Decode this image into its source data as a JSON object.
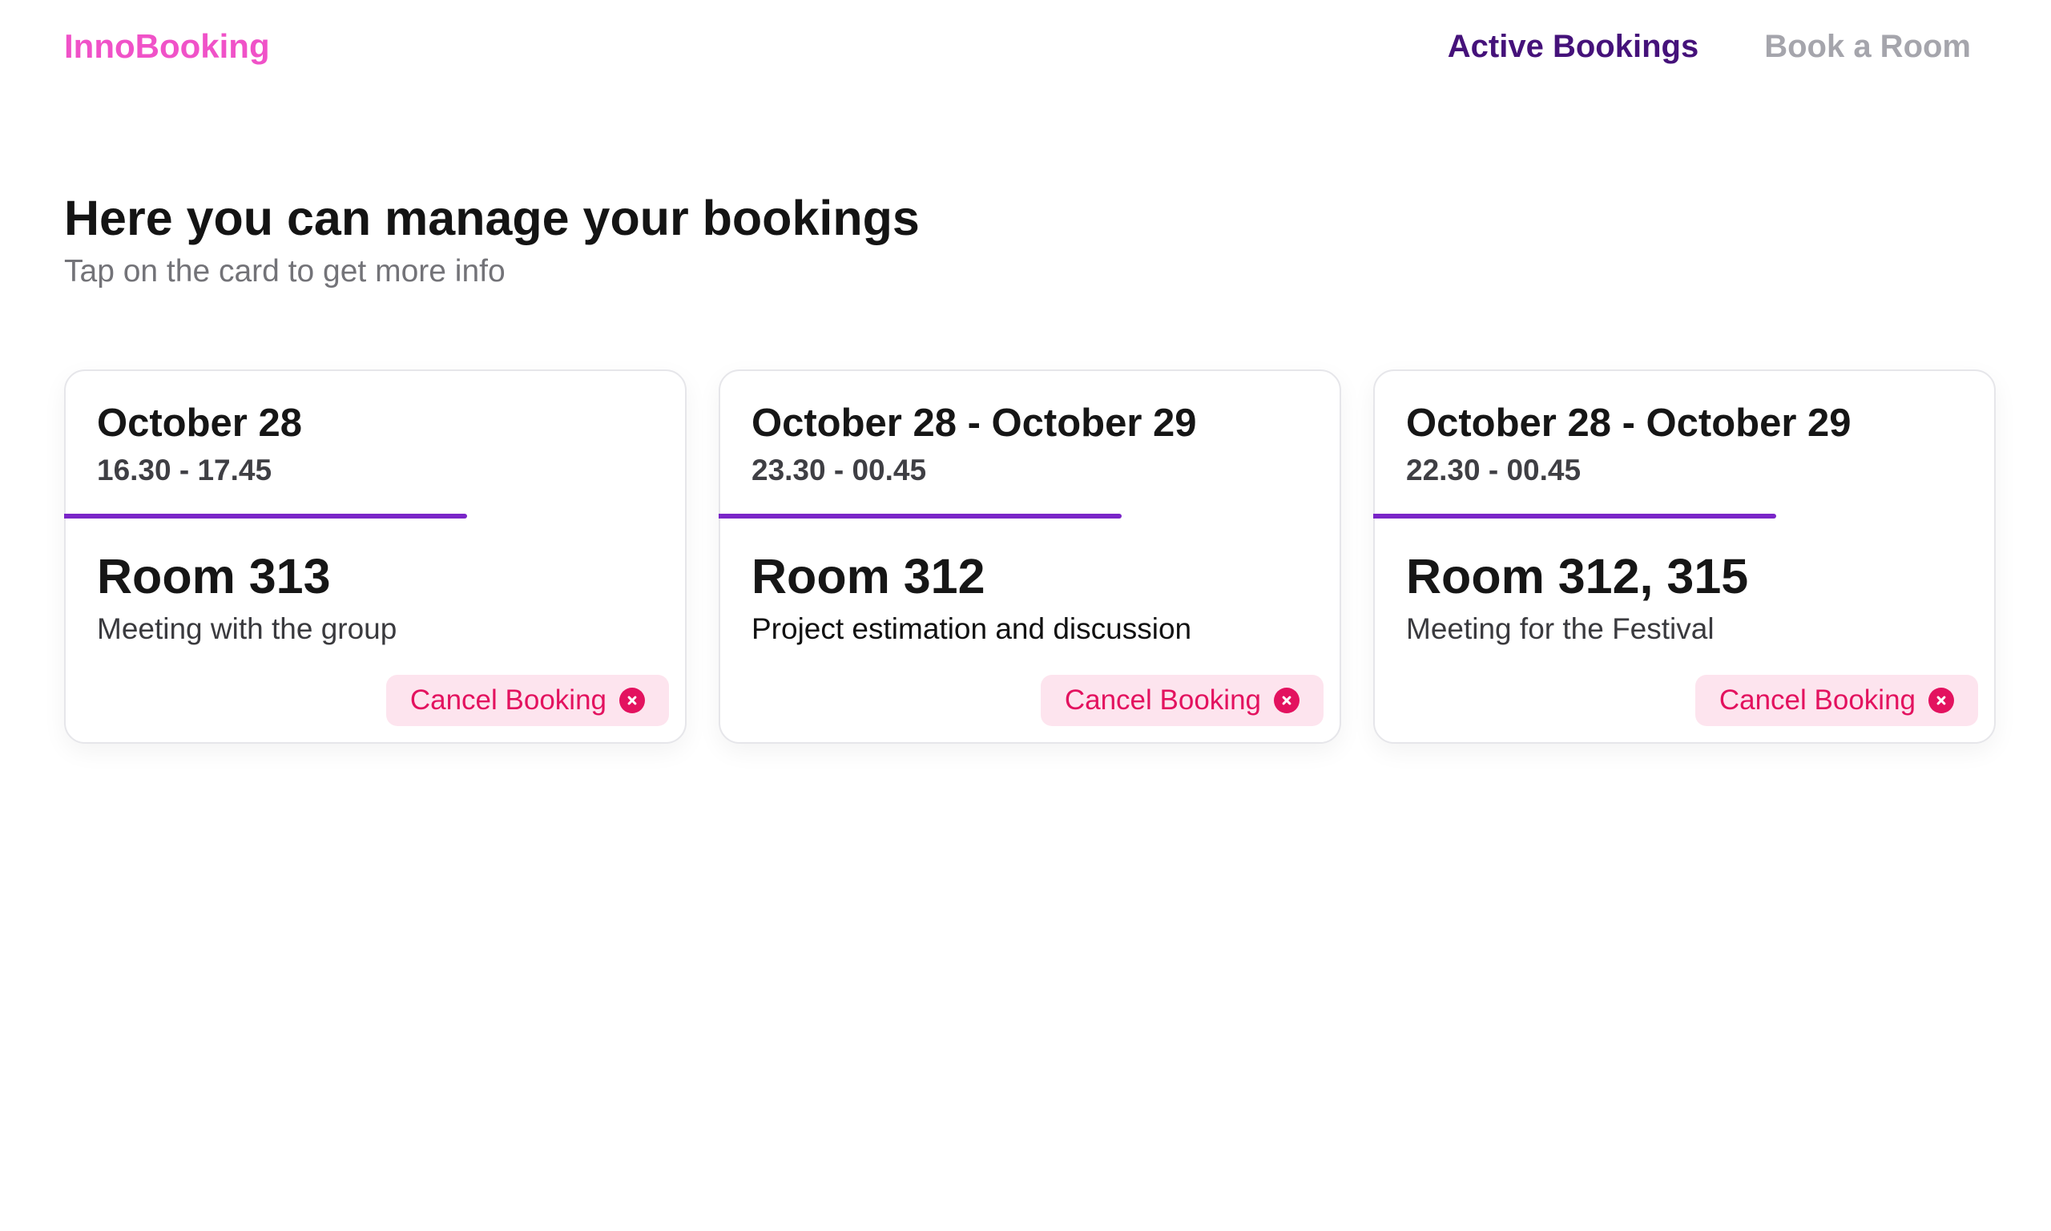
{
  "header": {
    "logo": "InnoBooking",
    "nav": [
      {
        "label": "Active Bookings",
        "active": true
      },
      {
        "label": "Book a Room",
        "active": false
      }
    ]
  },
  "intro": {
    "title": "Here you can manage your bookings",
    "subtitle": "Tap on the card to get more info"
  },
  "bookings": [
    {
      "date": "October 28",
      "time": "16.30 - 17.45",
      "room": "Room 313",
      "description": "Meeting with the group",
      "cancel_label": "Cancel Booking"
    },
    {
      "date": "October 28 - October 29",
      "time": "23.30 - 00.45",
      "room": "Room 312",
      "description": "Project estimation and discussion",
      "cancel_label": "Cancel Booking"
    },
    {
      "date": "October 28 - October 29",
      "time": "22.30 - 00.45",
      "room": "Room 312, 315",
      "description": "Meeting for the Festival",
      "cancel_label": "Cancel Booking"
    }
  ],
  "colors": {
    "brand_pink": "#f052c8",
    "nav_active": "#45127a",
    "nav_inactive": "#a5a5ac",
    "divider_purple": "#7a25c8",
    "cancel_red": "#e3125f",
    "cancel_bg": "#fde4ee"
  },
  "icons": {
    "cancel": "close-circle-icon"
  }
}
